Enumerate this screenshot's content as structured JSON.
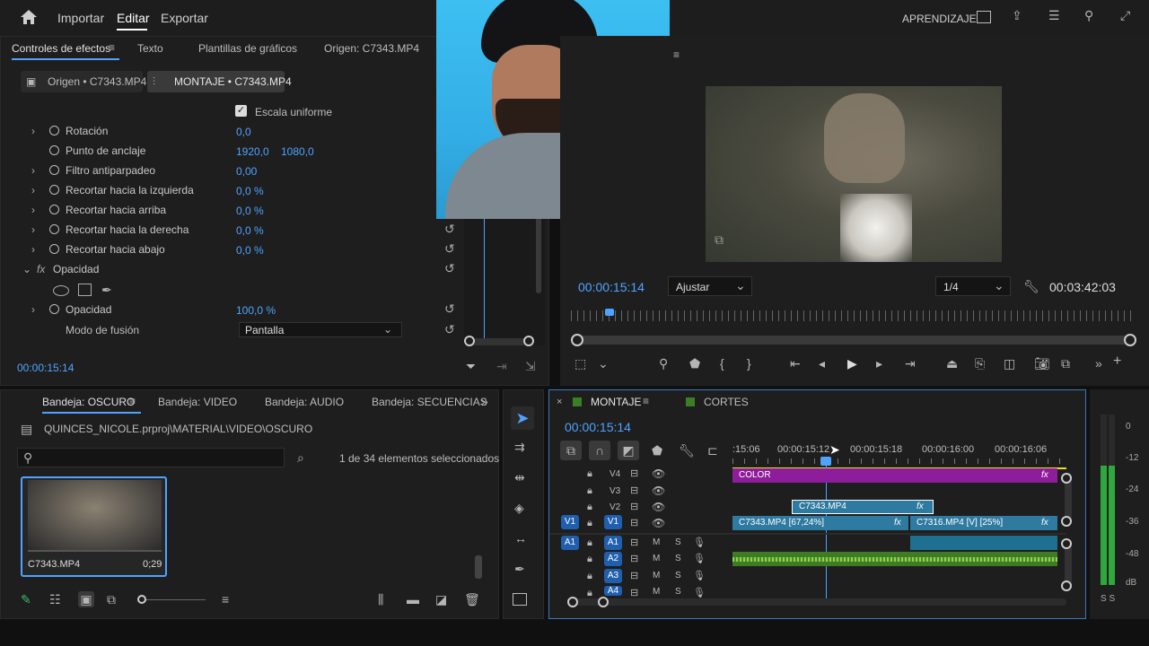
{
  "topbar": {
    "home_icon": "home-icon",
    "import": "Importar",
    "edit": "Editar",
    "export": "Exportar",
    "learn": "APRENDIZAJE"
  },
  "effects": {
    "tabs": [
      "Controles de efectos",
      "Texto",
      "Plantillas de gráficos",
      "Origen: C7343.MP4"
    ],
    "subtab_source": "Origen • C7343.MP4",
    "subtab_sequence": "MONTAJE • C7343.MP4",
    "uniform_scale": "Escala uniforme",
    "rows": [
      {
        "label": "Rotación",
        "v1": "0,0",
        "v2": ""
      },
      {
        "label": "Punto de anclaje",
        "v1": "1920,0",
        "v2": "1080,0"
      },
      {
        "label": "Filtro antiparpadeo",
        "v1": "0,00",
        "v2": ""
      },
      {
        "label": "Recortar hacia la izquierda",
        "v1": "0,0 %",
        "v2": ""
      },
      {
        "label": "Recortar hacia arriba",
        "v1": "0,0 %",
        "v2": ""
      },
      {
        "label": "Recortar hacia la derecha",
        "v1": "0,0 %",
        "v2": ""
      },
      {
        "label": "Recortar hacia abajo",
        "v1": "0,0 %",
        "v2": ""
      }
    ],
    "opacity_header": "Opacidad",
    "opacity_label": "Opacidad",
    "opacity_value": "100,0 %",
    "blend_label": "Modo de fusión",
    "blend_value": "Pantalla",
    "timecode": "00:00:15:14"
  },
  "program": {
    "timecode": "00:00:15:14",
    "fit": "Ajustar",
    "resolution": "1/4",
    "duration": "00:03:42:03"
  },
  "bin": {
    "tabs": [
      "Bandeja: OSCURO",
      "Bandeja: VIDEO",
      "Bandeja: AUDIO",
      "Bandeja: SECUENCIAS"
    ],
    "path": "QUINCES_NICOLE.prproj\\MATERIAL\\VIDEO\\OSCURO",
    "selected": "1 de 34 elementos seleccionados",
    "clip_name": "C7343.MP4",
    "clip_dur": "0;29"
  },
  "timeline": {
    "tabs": [
      "MONTAJE",
      "CORTES"
    ],
    "timecode": "00:00:15:14",
    "ruler": [
      ":15:06",
      "00:00:15:12",
      "00:00:15:18",
      "00:00:16:00",
      "00:00:16:06"
    ],
    "tracks_video": [
      "V4",
      "V3",
      "V2",
      "V1"
    ],
    "tracks_audio": [
      "A1",
      "A2",
      "A3",
      "A4"
    ],
    "src_v": "V1",
    "src_a": "A1",
    "clip_color": "COLOR",
    "clip_v2": "C7343.MP4",
    "clip_v1a": "C7343.MP4 [67,24%]",
    "clip_v1b": "C7316.MP4 [V] [25%]",
    "m": "M",
    "s": "S",
    "fx": "fx"
  },
  "meter": {
    "labels": [
      "0",
      "-12",
      "-24",
      "-36",
      "-48",
      "dB"
    ],
    "foot": "S S"
  }
}
